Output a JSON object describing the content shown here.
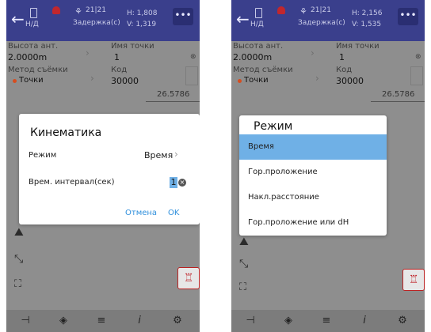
{
  "left": {
    "header": {
      "fix_label": "Н/Д",
      "sats": "21|21",
      "delay_label": "Задержка(с)",
      "h_value": "H: 1,808",
      "v_value": "V: 1,319",
      "menu_label": "•••"
    },
    "form": {
      "antenna_height_label": "Высота ант.",
      "antenna_height_value": "2.0000m",
      "point_name_label": "Имя точки",
      "point_name_value": "1",
      "method_label": "Метод съёмки",
      "method_value": "Точки",
      "code_label": "Код",
      "code_value": "30000",
      "distance_value": "26.5786"
    },
    "dialog": {
      "title": "Кинематика",
      "mode_label": "Режим",
      "mode_value": "Время",
      "interval_label": "Врем. интервал(сек)",
      "interval_value": "1",
      "cancel_label": "Отмена",
      "ok_label": "OK"
    }
  },
  "right": {
    "header": {
      "fix_label": "Н/Д",
      "sats": "21|21",
      "delay_label": "Задержка(с)",
      "h_value": "H: 2,156",
      "v_value": "V: 1,535",
      "menu_label": "•••"
    },
    "form": {
      "antenna_height_label": "Высота ант.",
      "antenna_height_value": "2.0000m",
      "point_name_label": "Имя точки",
      "point_name_value": "1",
      "method_label": "Метод съёмки",
      "method_value": "Точки",
      "code_label": "Код",
      "code_value": "30000",
      "distance_value": "26.5786"
    },
    "dialog": {
      "title": "Режим",
      "options": [
        "Время",
        "Гор.проложение",
        "Накл.расстояние",
        "Гор.проложение или dH"
      ],
      "selected_index": 0
    }
  },
  "colors": {
    "header": "#3a3f8c",
    "overlay": "#8e8e8e",
    "accent": "#2f8fdc",
    "selected": "#6fb0e6",
    "red": "#c1272d"
  },
  "icons": [
    "back-arrow-icon",
    "phone-icon",
    "satellite-icon",
    "menu-dots-icon",
    "points-map-icon",
    "collapse-icon",
    "expand-icon",
    "stakeout-icon",
    "ruler-icon",
    "layers-icon",
    "list-icon",
    "info-icon",
    "settings-icon",
    "clear-icon"
  ]
}
